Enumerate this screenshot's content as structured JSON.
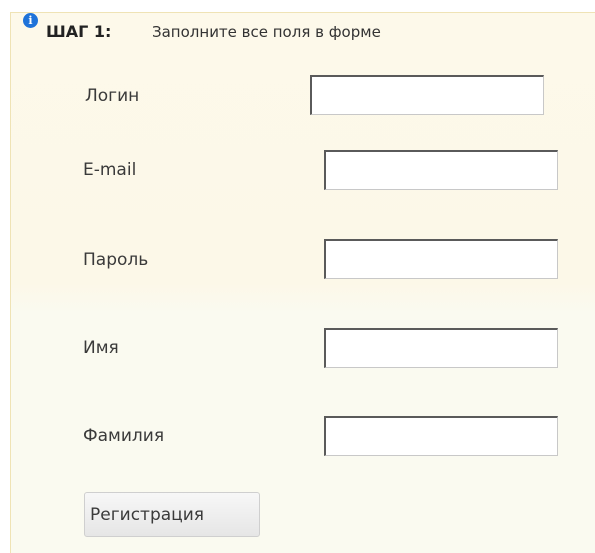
{
  "step": {
    "icon": "info-icon",
    "icon_glyph": "i",
    "label": "ШАГ 1:",
    "instruction": "Заполните все поля в форме"
  },
  "form": {
    "fields": [
      {
        "label": "Логин",
        "value": "",
        "placeholder": ""
      },
      {
        "label": "E-mail",
        "value": "",
        "placeholder": ""
      },
      {
        "label": "Пароль",
        "value": "",
        "placeholder": ""
      },
      {
        "label": "Имя",
        "value": "",
        "placeholder": ""
      },
      {
        "label": "Фамилия",
        "value": "",
        "placeholder": ""
      }
    ],
    "submit_label": "Регистрация"
  },
  "colors": {
    "panel_background": "#fcf8e8",
    "panel_border": "#efe3b5",
    "info_icon": "#1f73d9"
  }
}
